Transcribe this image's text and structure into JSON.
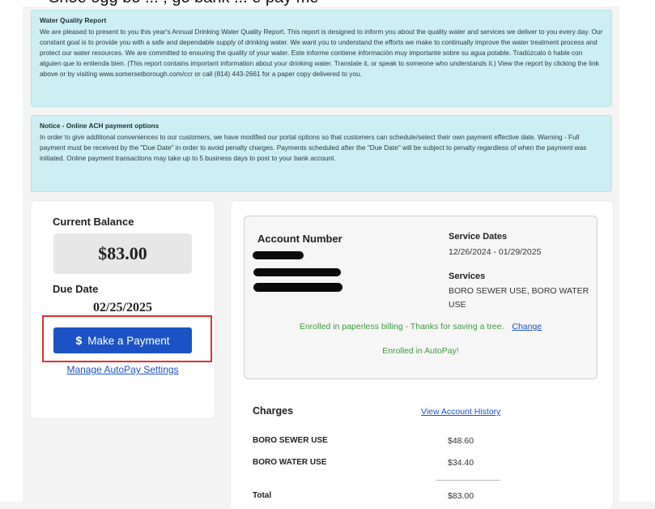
{
  "top_partial_text": "Shoe ogg bo ... ; go bank ... e pay me",
  "notices": [
    {
      "title": "Water Quality Report",
      "body": "We are pleased to present to you this year's Annual Drinking Water Quality Report. This report is designed to inform you about the quality water and services we deliver to you every day. Our constant goal is to provide you with a safe and dependable supply of drinking water. We want you to understand the efforts we make to continually improve the water treatment process and protect our water resources. We are committed to ensuring the quality of your water. Este informe contiene información muy importante sobre su agua potable. Tradúzcalo ó hable con alguien que lo entienda bien. (This report contains important information about your drinking water. Translate it, or speak to someone who understands it.) View the report by clicking the link above or by visiting www.somersetborough.com/ccr or call (814) 443-2661 for a paper copy delivered to you."
    },
    {
      "title": "Notice - Online ACH payment options",
      "body": "In order to give additional conveniences to our customers, we have modified our portal options so that customers can schedule/select their own payment effective date. Warning - Full payment must be received by the \"Due Date\" in order to avoid penalty charges. Payments scheduled after the \"Due Date\" will be subject to penalty regardless of when the payment was initiated. Online payment transactions may take up to 5 business days to post to your bank account."
    }
  ],
  "balance": {
    "current_balance_label": "Current Balance",
    "current_balance": "$83.00",
    "due_date_label": "Due Date",
    "due_date": "02/25/2025",
    "pay_button_icon": "$",
    "pay_button_label": "Make a Payment",
    "autopay_link": "Manage AutoPay Settings"
  },
  "account": {
    "account_number_label": "Account Number",
    "service_dates_label": "Service Dates",
    "service_dates": "12/26/2024 - 01/29/2025",
    "services_label": "Services",
    "services": "BORO SEWER USE, BORO WATER USE",
    "paperless_text": "Enrolled in paperless billing - Thanks for saving a tree.",
    "change_link": "Change",
    "autopay_text": "Enrolled in AutoPay!"
  },
  "charges": {
    "label": "Charges",
    "history_link": "View Account History",
    "rows": [
      {
        "name": "BORO SEWER USE",
        "amount": "$48.60"
      },
      {
        "name": "BORO WATER USE",
        "amount": "$34.40"
      }
    ],
    "total_label": "Total",
    "total_amount": "$83.00"
  },
  "colors": {
    "notice_bg": "#cdeef2",
    "primary_button": "#1b53c4",
    "link": "#1b53c4",
    "enrolled_green": "#3a9d3a",
    "highlight_red": "#e03030"
  }
}
